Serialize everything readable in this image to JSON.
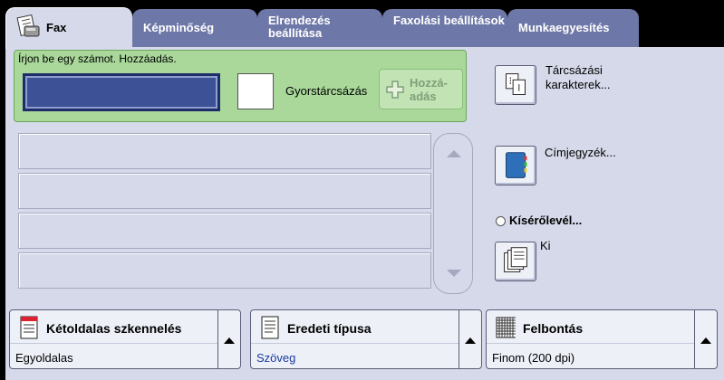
{
  "tabs": [
    {
      "label": "Fax",
      "active": true
    },
    {
      "label": "Képminőség"
    },
    {
      "label": "Elrendezés beállítása"
    },
    {
      "label": "Faxolási beállítások"
    },
    {
      "label": "Munkaegyesítés"
    }
  ],
  "entry": {
    "prompt": "Írjon be egy számot. Hozzáadás.",
    "number_value": "",
    "speed_dial_label": "Gyorstárcsázás",
    "add_label": "Hozzá- adás"
  },
  "recipient_list": {
    "rows": [
      "",
      "",
      "",
      ""
    ]
  },
  "side": {
    "dial_chars_label": "Tárcsázási karakterek...",
    "address_book_label": "Címjegyzék...",
    "cover_sheet_label": "Kísérőlevél...",
    "cover_sheet_value": "Ki"
  },
  "options": [
    {
      "title": "Kétoldalas szkennelés",
      "value": "Egyoldalas",
      "value_color": "#000000"
    },
    {
      "title": "Eredeti típusa",
      "value": "Szöveg",
      "value_color": "#1a3a9c"
    },
    {
      "title": "Felbontás",
      "value": "Finom (200 dpi)",
      "value_color": "#000000"
    }
  ],
  "colors": {
    "tab_inactive": "#6e78a8",
    "panel": "#d6d9ea",
    "entry_area": "#a9d89a",
    "number_field": "#3d5296"
  }
}
